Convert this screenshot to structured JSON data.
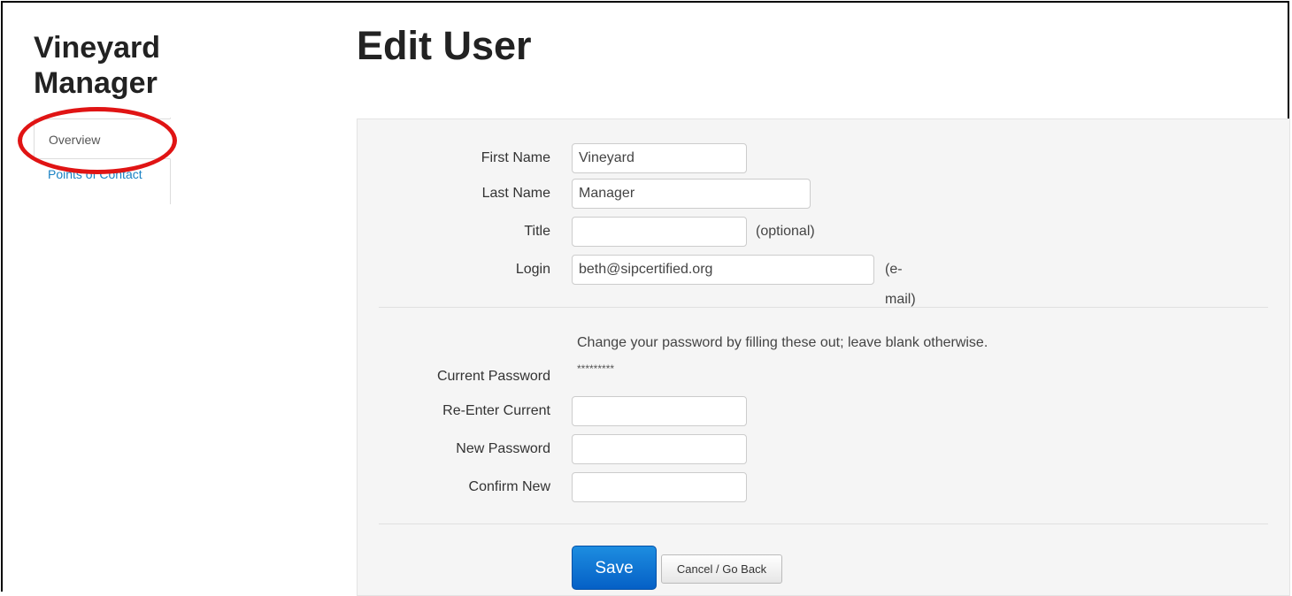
{
  "brand": {
    "line1": "Vineyard",
    "line2": "Manager"
  },
  "page": {
    "title": "Edit User"
  },
  "nav": {
    "items": [
      {
        "label": "Overview",
        "active": true
      },
      {
        "label": "Points of Contact",
        "active": false
      }
    ]
  },
  "form": {
    "first_name": {
      "label": "First Name",
      "value": "Vineyard"
    },
    "last_name": {
      "label": "Last Name",
      "value": "Manager"
    },
    "title": {
      "label": "Title",
      "value": "",
      "hint": "(optional)"
    },
    "login": {
      "label": "Login",
      "value": "beth@sipcertified.org",
      "hint": "(e-mail)"
    },
    "password_note": "Change your password by filling these out; leave blank otherwise.",
    "current_password": {
      "label": "Current Password",
      "value": "*********"
    },
    "reenter_current": {
      "label": "Re-Enter Current",
      "value": ""
    },
    "new_password": {
      "label": "New Password",
      "value": ""
    },
    "confirm_new": {
      "label": "Confirm New",
      "value": ""
    }
  },
  "actions": {
    "save_label": "Save",
    "cancel_label": "Cancel / Go Back"
  },
  "colors": {
    "link": "#1a82c4",
    "save_button": "#0a6fd6",
    "highlight_ring": "#e01414",
    "panel_bg": "#f5f5f5"
  }
}
